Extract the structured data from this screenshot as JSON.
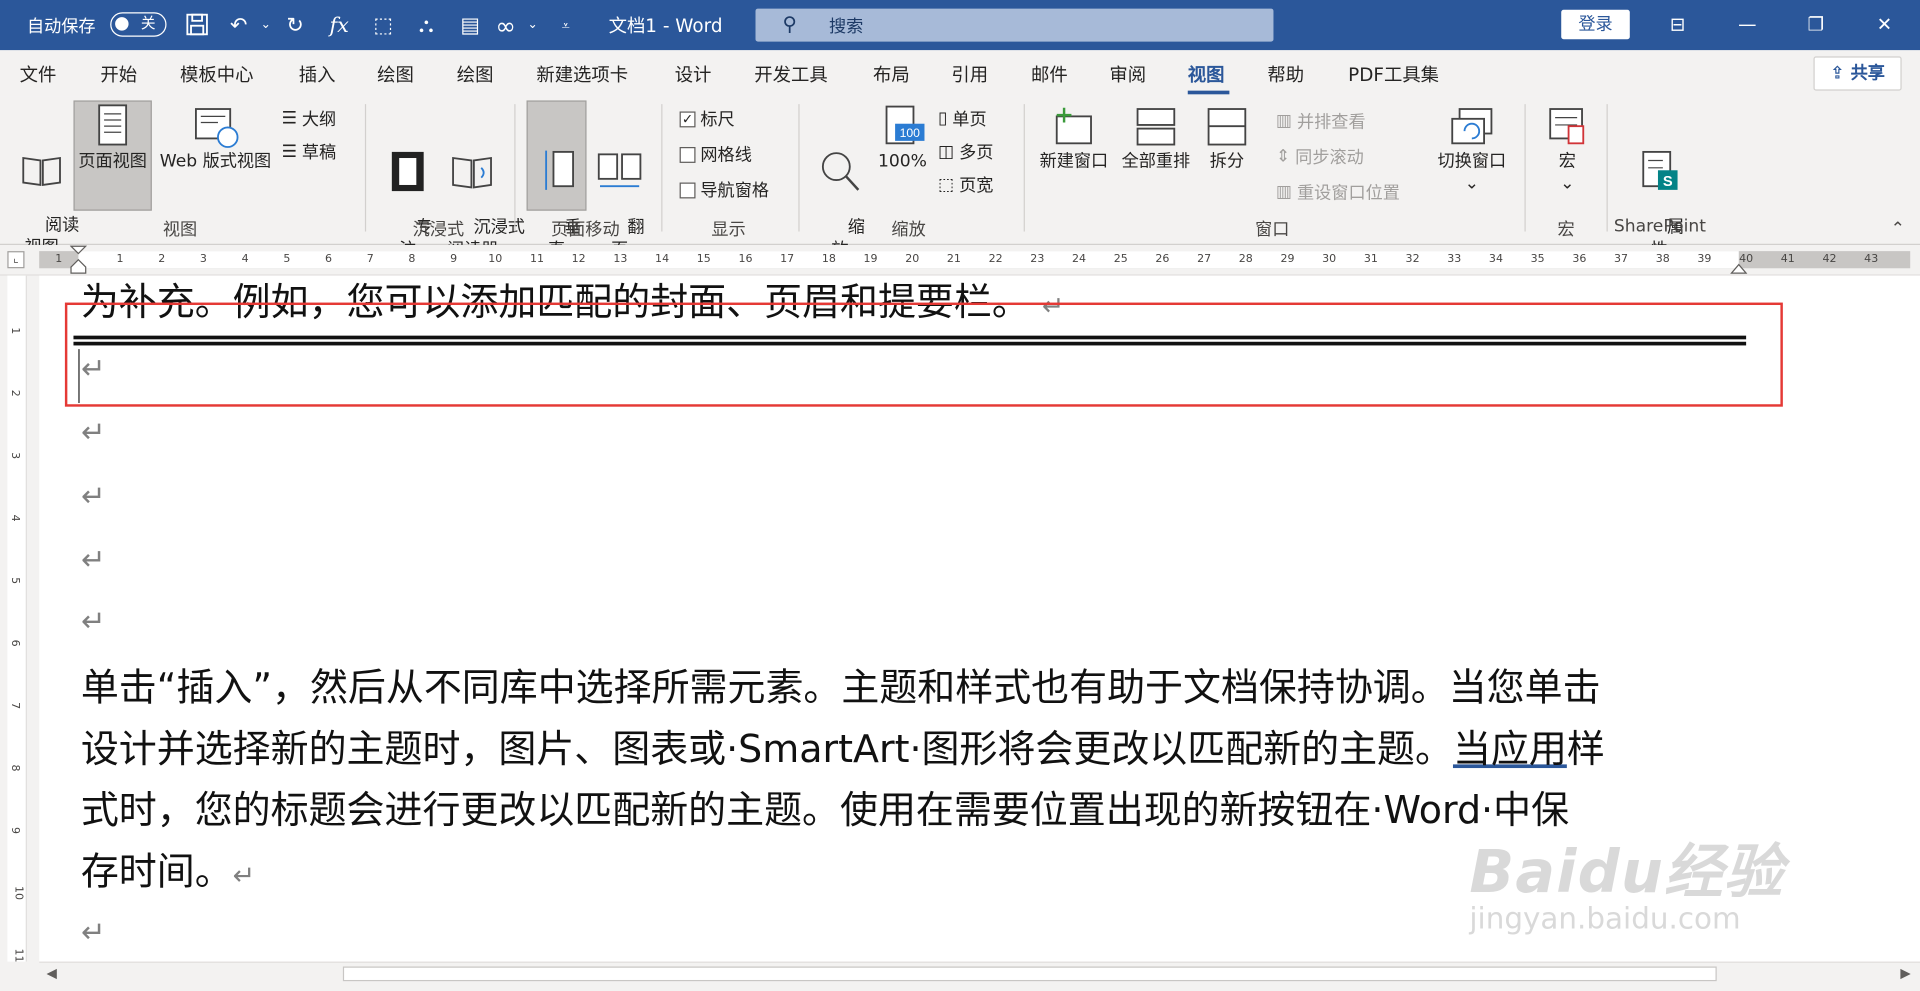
{
  "titlebar": {
    "autosave_label": "自动保存",
    "autosave_state": "关",
    "doc_title": "文档1 - Word",
    "search_placeholder": "搜索",
    "login_label": "登录",
    "quick_access_icons": [
      "save-icon",
      "undo-icon",
      "redo-icon",
      "function-icon",
      "select-icon",
      "hierarchy-icon",
      "document-icon",
      "infinity-icon",
      "customize-icon"
    ],
    "window_controls": [
      "ribbon-display-icon",
      "minimize-icon",
      "restore-icon",
      "close-icon"
    ]
  },
  "tabs": [
    "文件",
    "开始",
    "模板中心",
    "插入",
    "绘图",
    "绘图",
    "新建选项卡",
    "设计",
    "开发工具",
    "布局",
    "引用",
    "邮件",
    "审阅",
    "视图",
    "帮助",
    "PDF工具集"
  ],
  "active_tab": "视图",
  "share_label": "共享",
  "ribbon": {
    "views": {
      "label": "视图",
      "read_mode": "阅读\n视图",
      "print_layout": "页面视图",
      "web_layout": "Web 版式视图",
      "outline": "大纲",
      "draft": "草稿"
    },
    "immersive": {
      "label": "沉浸式",
      "focus": "专\n注",
      "immersive_reader": "沉浸式\n阅读器"
    },
    "page_movement": {
      "label": "页面移动",
      "vertical": "垂\n直",
      "side_to_side": "翻\n页"
    },
    "show": {
      "label": "显示",
      "ruler": "标尺",
      "ruler_checked": true,
      "gridlines": "网格线",
      "gridlines_checked": false,
      "nav_pane": "导航窗格",
      "nav_pane_checked": false
    },
    "zoom": {
      "label": "缩放",
      "zoom": "缩\n放",
      "hundred": "100%",
      "hundred_icon_text": "100",
      "one_page": "单页",
      "multiple_pages": "多页",
      "page_width": "页宽"
    },
    "window": {
      "label": "窗口",
      "new_window": "新建窗口",
      "arrange_all": "全部重排",
      "split": "拆分",
      "side_by_side": "并排查看",
      "sync_scroll": "同步滚动",
      "reset_position": "重设窗口位置",
      "switch_windows": "切换窗口"
    },
    "macros": {
      "label": "宏",
      "macros": "宏"
    },
    "sharepoint": {
      "label": "SharePoint",
      "properties": "属\n性"
    }
  },
  "ruler": {
    "numbers": [
      "1",
      "1",
      "2",
      "3",
      "4",
      "5",
      "6",
      "7",
      "8",
      "9",
      "10",
      "11",
      "12",
      "13",
      "14",
      "15",
      "16",
      "17",
      "18",
      "19",
      "20",
      "21",
      "22",
      "23",
      "24",
      "25",
      "26",
      "27",
      "28",
      "29",
      "30",
      "31",
      "32",
      "33",
      "34",
      "35",
      "36",
      "37",
      "38",
      "39",
      "40",
      "41",
      "42",
      "43"
    ],
    "vertical_numbers": [
      "1",
      "2",
      "3",
      "4",
      "5",
      "6",
      "7",
      "8",
      "9",
      "10",
      "11"
    ]
  },
  "document": {
    "top_line": "为补充。例如，您可以添加匹配的封面、页眉和提要栏。",
    "paragraph_mark": "↵",
    "body_lines": [
      "单击“插入”，然后从不同库中选择所需元素。主题和样式也有助于文档保持协调。当您单击",
      "设计并选择新的主题时，图片、图表或·SmartArt·图形将会更改以匹配新的主题。",
      "式时，您的标题会进行更改以匹配新的主题。使用在需要位置出现的新按钮在·Word·中保",
      "存时间。"
    ],
    "underlined_text": "当应用",
    "line2_tail": "样"
  },
  "watermark": {
    "brand": "Baidu经验",
    "url": "jingyan.baidu.com"
  }
}
